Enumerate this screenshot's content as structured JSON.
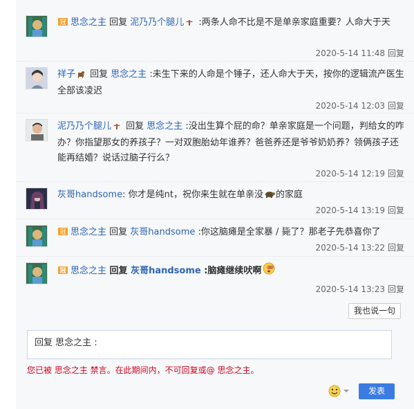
{
  "replies": [
    {
      "author": "思念之主",
      "parts": [
        {
          "t": "kw",
          "v": " 回复 "
        },
        {
          "t": "user",
          "v": "泥乃乃个腿儿"
        },
        {
          "t": "text",
          "v": " :两条人命不比是不是单亲家庭重要？人命大于天"
        }
      ],
      "time": "2020-5-14 11:48",
      "reply_label": "回复"
    },
    {
      "author": "祥子",
      "parts": [
        {
          "t": "kw",
          "v": " 回复 "
        },
        {
          "t": "user",
          "v": "思念之主"
        },
        {
          "t": "text",
          "v": " :未生下来的人命是个锤子，还人命大于天，按你的逻辑流产医生全部该凌迟"
        }
      ],
      "time": "2020-5-14 12:03",
      "reply_label": "回复"
    },
    {
      "author": "泥乃乃个腿儿",
      "parts": [
        {
          "t": "kw",
          "v": " 回复 "
        },
        {
          "t": "user",
          "v": "思念之主"
        },
        {
          "t": "text",
          "v": " :没出生算个屁的命？单亲家庭是一个问题，判给女的咋办？你指望那女的养孩子？一对双胞胎幼年谁养？爸爸养还是爷爷奶奶养？领俩孩子还能再结婚？说话过脑子行么？"
        }
      ],
      "time": "2020-5-14 12:19",
      "reply_label": "回复"
    },
    {
      "author": "灰哥handsome",
      "parts": [
        {
          "t": "text",
          "v": ": 你才是纯nt，祝你来生就在单亲没"
        },
        {
          "t": "text",
          "v": "的家庭"
        }
      ],
      "time": "2020-5-14 13:19",
      "reply_label": "回复"
    },
    {
      "author": "思念之主",
      "parts": [
        {
          "t": "kw",
          "v": " 回复 "
        },
        {
          "t": "user",
          "v": "灰哥handsome"
        },
        {
          "t": "text",
          "v": " :你这脑瘫是全家暴 / 毙了？那老子先恭喜你了"
        }
      ],
      "time": "2020-5-14 13:22",
      "reply_label": "回复"
    },
    {
      "author": "思念之主",
      "bold": true,
      "parts": [
        {
          "t": "kw",
          "v": " 回复 "
        },
        {
          "t": "user",
          "v": "灰哥handsome"
        },
        {
          "t": "text",
          "v": " :脑瘫继续吠啊"
        }
      ],
      "time": "2020-5-14 13:23",
      "reply_label": "回复"
    }
  ],
  "say_button": "我也说一句",
  "editor_text": "回复 思念之主 :",
  "warning": "您已被 思念之主 禁言。在此期间内，不可回复或@ 思念之主。",
  "send_button": "发表",
  "icons": {
    "crown": "crown-badge-icon",
    "mushroom": "mushroom-badge-icon",
    "emoji": "smiley-icon"
  }
}
